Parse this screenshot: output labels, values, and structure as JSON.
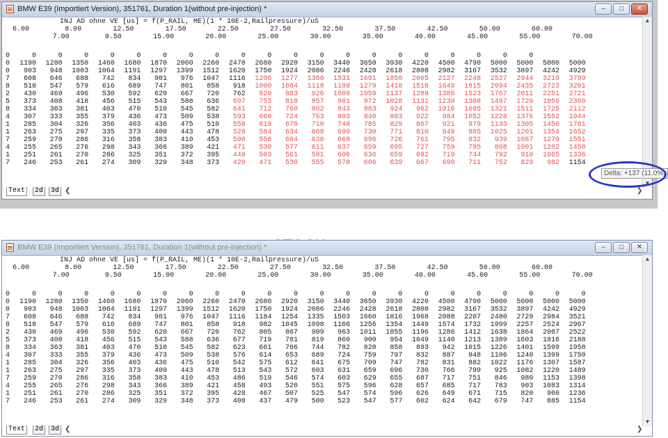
{
  "window_title": "BMW E39 (Importiert Version), 351761, Duration 1(without pre-injection) *",
  "window_title_2": "BMW E39 (Importiert Version), 351761, Duration 1(without pre-injection) *",
  "header_line": "INJ AD ohne VE [us] = f(P_RAIL, ME)(1 * 10E-2,Railpressure)/uS",
  "axis_upper": [
    "6.00",
    "12.50",
    "17.50",
    "22.50",
    "27.50",
    "32.50",
    "37.50",
    "42.50",
    "50.00",
    "60.00"
  ],
  "axis_lower": [
    "7.00",
    "8.00",
    "9.50",
    "15.00",
    "20.00",
    "25.00",
    "30.00",
    "35.00",
    "40.00",
    "45.00",
    "55.00",
    "70.00"
  ],
  "axis_upper_top": [
    "6.00",
    "8.00",
    "12.50",
    "17.50",
    "22.50",
    "27.50",
    "32.50",
    "37.50",
    "42.50",
    "50.00",
    "60.00"
  ],
  "axis_lower_top": [
    "7.00",
    "9.50",
    "15.00",
    "20.00",
    "25.00",
    "30.00",
    "35.00",
    "40.00",
    "45.00",
    "55.00",
    "70.00"
  ],
  "row_labels": [
    "0",
    "0",
    "0",
    "7",
    "8",
    "2",
    "5",
    "8",
    "4",
    "1",
    "1",
    "7",
    "4",
    "1",
    "7"
  ],
  "modified_rows": [
    [
      "0",
      "0",
      "0",
      "0",
      "0",
      "0",
      "0",
      "0",
      "0",
      "0",
      "0",
      "0",
      "0",
      "0",
      "0",
      "0",
      "0",
      "0",
      "0",
      "0"
    ],
    [
      "1190",
      "1280",
      "1350",
      "1460",
      "1680",
      "1870",
      "2060",
      "2260",
      "2470",
      "2680",
      "2920",
      "3150",
      "3440",
      "3650",
      "3930",
      "4220",
      "4500",
      "4790",
      "5000",
      "5000",
      "5000",
      "5000"
    ],
    [
      "903",
      "948",
      "1003",
      "1064",
      "1191",
      "1297",
      "1399",
      "1512",
      "1620",
      "1750",
      "1924",
      "2086",
      "2246",
      "2428",
      "2618",
      "2808",
      "2982",
      "3167",
      "3532",
      "3897",
      "4242",
      "4929"
    ],
    [
      "608",
      "646",
      "688",
      "742",
      "834",
      "901",
      "976",
      "1047",
      "1116",
      "1206",
      "1277",
      "1360",
      "1531",
      "1691",
      "1850",
      "2005",
      "2127",
      "2248",
      "2527",
      "2944",
      "3219",
      "3799"
    ],
    [
      "518",
      "547",
      "579",
      "616",
      "689",
      "747",
      "801",
      "858",
      "918",
      "1000",
      "1064",
      "1118",
      "1188",
      "1279",
      "1418",
      "1518",
      "1649",
      "1815",
      "2094",
      "2435",
      "2723",
      "3201"
    ],
    [
      "430",
      "469",
      "496",
      "530",
      "592",
      "620",
      "667",
      "720",
      "762",
      "820",
      "883",
      "926",
      "1009",
      "1059",
      "1137",
      "1289",
      "1386",
      "1523",
      "1767",
      "2011",
      "2251",
      "2721"
    ],
    [
      "373",
      "408",
      "418",
      "456",
      "515",
      "543",
      "588",
      "636",
      "697",
      "753",
      "818",
      "857",
      "901",
      "972",
      "1028",
      "1131",
      "1230",
      "1308",
      "1497",
      "1729",
      "1959",
      "2360"
    ],
    [
      "334",
      "363",
      "381",
      "403",
      "470",
      "510",
      "545",
      "582",
      "641",
      "712",
      "760",
      "802",
      "843",
      "883",
      "924",
      "962",
      "1016",
      "1095",
      "1321",
      "1511",
      "1725",
      "2112"
    ],
    [
      "307",
      "333",
      "355",
      "379",
      "436",
      "473",
      "509",
      "538",
      "593",
      "660",
      "724",
      "763",
      "803",
      "840",
      "883",
      "922",
      "984",
      "1052",
      "1228",
      "1376",
      "1552",
      "1944"
    ],
    [
      "285",
      "304",
      "326",
      "356",
      "403",
      "436",
      "475",
      "510",
      "558",
      "619",
      "678",
      "710",
      "748",
      "785",
      "829",
      "867",
      "921",
      "979",
      "1133",
      "1305",
      "1450",
      "1761"
    ],
    [
      "263",
      "275",
      "297",
      "335",
      "373",
      "400",
      "443",
      "478",
      "528",
      "584",
      "634",
      "668",
      "699",
      "730",
      "771",
      "810",
      "849",
      "885",
      "1025",
      "1201",
      "1354",
      "1652"
    ],
    [
      "259",
      "270",
      "286",
      "316",
      "358",
      "383",
      "410",
      "453",
      "500",
      "558",
      "604",
      "636",
      "668",
      "696",
      "726",
      "761",
      "795",
      "832",
      "939",
      "1087",
      "1279",
      "1551"
    ],
    [
      "255",
      "265",
      "276",
      "298",
      "343",
      "366",
      "389",
      "421",
      "471",
      "530",
      "577",
      "611",
      "637",
      "659",
      "695",
      "727",
      "759",
      "795",
      "868",
      "1001",
      "1202",
      "1458"
    ],
    [
      "251",
      "261",
      "270",
      "286",
      "325",
      "351",
      "372",
      "395",
      "440",
      "503",
      "561",
      "581",
      "606",
      "636",
      "659",
      "692",
      "719",
      "744",
      "792",
      "910",
      "1065",
      "1336"
    ],
    [
      "246",
      "253",
      "261",
      "274",
      "309",
      "329",
      "348",
      "373",
      "420",
      "471",
      "530",
      "555",
      "578",
      "606",
      "639",
      "667",
      "690",
      "711",
      "752",
      "829",
      "982",
      "1154"
    ]
  ],
  "stock_rows": [
    [
      "0",
      "0",
      "0",
      "0",
      "0",
      "0",
      "0",
      "0",
      "0",
      "0",
      "0",
      "0",
      "0",
      "0",
      "0",
      "0",
      "0",
      "0",
      "0",
      "0",
      "0",
      "0"
    ],
    [
      "1190",
      "1280",
      "1350",
      "1460",
      "1680",
      "1870",
      "2060",
      "2260",
      "2470",
      "2680",
      "2920",
      "3150",
      "3440",
      "3650",
      "3930",
      "4220",
      "4500",
      "4790",
      "5000",
      "5000",
      "5000",
      "5000"
    ],
    [
      "903",
      "948",
      "1003",
      "1064",
      "1191",
      "1297",
      "1399",
      "1512",
      "1620",
      "1750",
      "1924",
      "2086",
      "2246",
      "2428",
      "2618",
      "2808",
      "2982",
      "3167",
      "3532",
      "3897",
      "4242",
      "4929"
    ],
    [
      "608",
      "646",
      "688",
      "742",
      "834",
      "901",
      "976",
      "1047",
      "1116",
      "1184",
      "1254",
      "1335",
      "1503",
      "1660",
      "1816",
      "1968",
      "2088",
      "2207",
      "2480",
      "2729",
      "2984",
      "3521"
    ],
    [
      "518",
      "547",
      "579",
      "616",
      "689",
      "747",
      "801",
      "858",
      "918",
      "982",
      "1045",
      "1098",
      "1166",
      "1256",
      "1354",
      "1449",
      "1574",
      "1732",
      "1999",
      "2257",
      "2524",
      "2967"
    ],
    [
      "430",
      "469",
      "496",
      "530",
      "592",
      "620",
      "667",
      "720",
      "762",
      "805",
      "867",
      "909",
      "963",
      "1011",
      "1055",
      "1196",
      "1286",
      "1412",
      "1638",
      "1864",
      "2087",
      "2522"
    ],
    [
      "373",
      "408",
      "418",
      "456",
      "515",
      "543",
      "588",
      "636",
      "677",
      "719",
      "781",
      "819",
      "860",
      "900",
      "954",
      "1049",
      "1140",
      "1213",
      "1389",
      "1603",
      "1816",
      "2188"
    ],
    [
      "334",
      "363",
      "381",
      "403",
      "470",
      "510",
      "545",
      "582",
      "623",
      "661",
      "706",
      "744",
      "782",
      "820",
      "858",
      "893",
      "942",
      "1015",
      "1226",
      "1401",
      "1599",
      "1958"
    ],
    [
      "307",
      "333",
      "355",
      "379",
      "436",
      "473",
      "509",
      "538",
      "576",
      "614",
      "653",
      "689",
      "724",
      "759",
      "797",
      "832",
      "887",
      "948",
      "1106",
      "1240",
      "1399",
      "1750"
    ],
    [
      "285",
      "304",
      "326",
      "356",
      "403",
      "436",
      "475",
      "510",
      "542",
      "575",
      "612",
      "641",
      "675",
      "709",
      "747",
      "782",
      "831",
      "882",
      "1022",
      "1176",
      "1307",
      "1587"
    ],
    [
      "263",
      "275",
      "297",
      "335",
      "373",
      "400",
      "443",
      "478",
      "513",
      "543",
      "572",
      "603",
      "631",
      "659",
      "696",
      "730",
      "766",
      "799",
      "925",
      "1082",
      "1220",
      "1489"
    ],
    [
      "259",
      "270",
      "286",
      "316",
      "358",
      "383",
      "410",
      "453",
      "486",
      "519",
      "546",
      "574",
      "603",
      "629",
      "655",
      "687",
      "717",
      "751",
      "846",
      "980",
      "1153",
      "1398"
    ],
    [
      "255",
      "265",
      "276",
      "298",
      "343",
      "366",
      "389",
      "421",
      "458",
      "493",
      "520",
      "551",
      "575",
      "596",
      "628",
      "657",
      "685",
      "717",
      "783",
      "903",
      "1083",
      "1314"
    ],
    [
      "251",
      "261",
      "270",
      "286",
      "325",
      "351",
      "372",
      "395",
      "428",
      "467",
      "507",
      "525",
      "547",
      "574",
      "596",
      "626",
      "649",
      "671",
      "715",
      "820",
      "960",
      "1236"
    ],
    [
      "246",
      "253",
      "261",
      "274",
      "309",
      "329",
      "348",
      "373",
      "408",
      "437",
      "479",
      "500",
      "523",
      "547",
      "577",
      "602",
      "624",
      "642",
      "679",
      "747",
      "885",
      "1154"
    ]
  ],
  "tabs": [
    "Text",
    "2d",
    "3d"
  ],
  "tooltip": "Delta: +137 (11.0%)",
  "stock_label": "STOCK:",
  "colors": {
    "changed": "#e05050",
    "normal": "#1a1a1a",
    "circle": "#2438c4",
    "stock": "#e03030"
  }
}
